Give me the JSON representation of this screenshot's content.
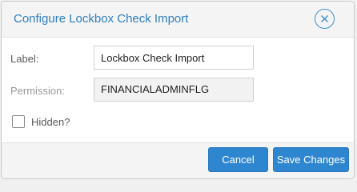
{
  "dialog": {
    "title": "Configure Lockbox Check Import",
    "close_icon": "close-icon"
  },
  "form": {
    "label_label": "Label:",
    "label_value": "Lockbox Check Import",
    "permission_label": "Permission:",
    "permission_value": "FINANCIALADMINFLG",
    "hidden_label": "Hidden?",
    "hidden_checked": false
  },
  "footer": {
    "cancel_label": "Cancel",
    "save_label": "Save Changes"
  },
  "colors": {
    "accent": "#2f86d0",
    "title": "#2f7fc1"
  }
}
